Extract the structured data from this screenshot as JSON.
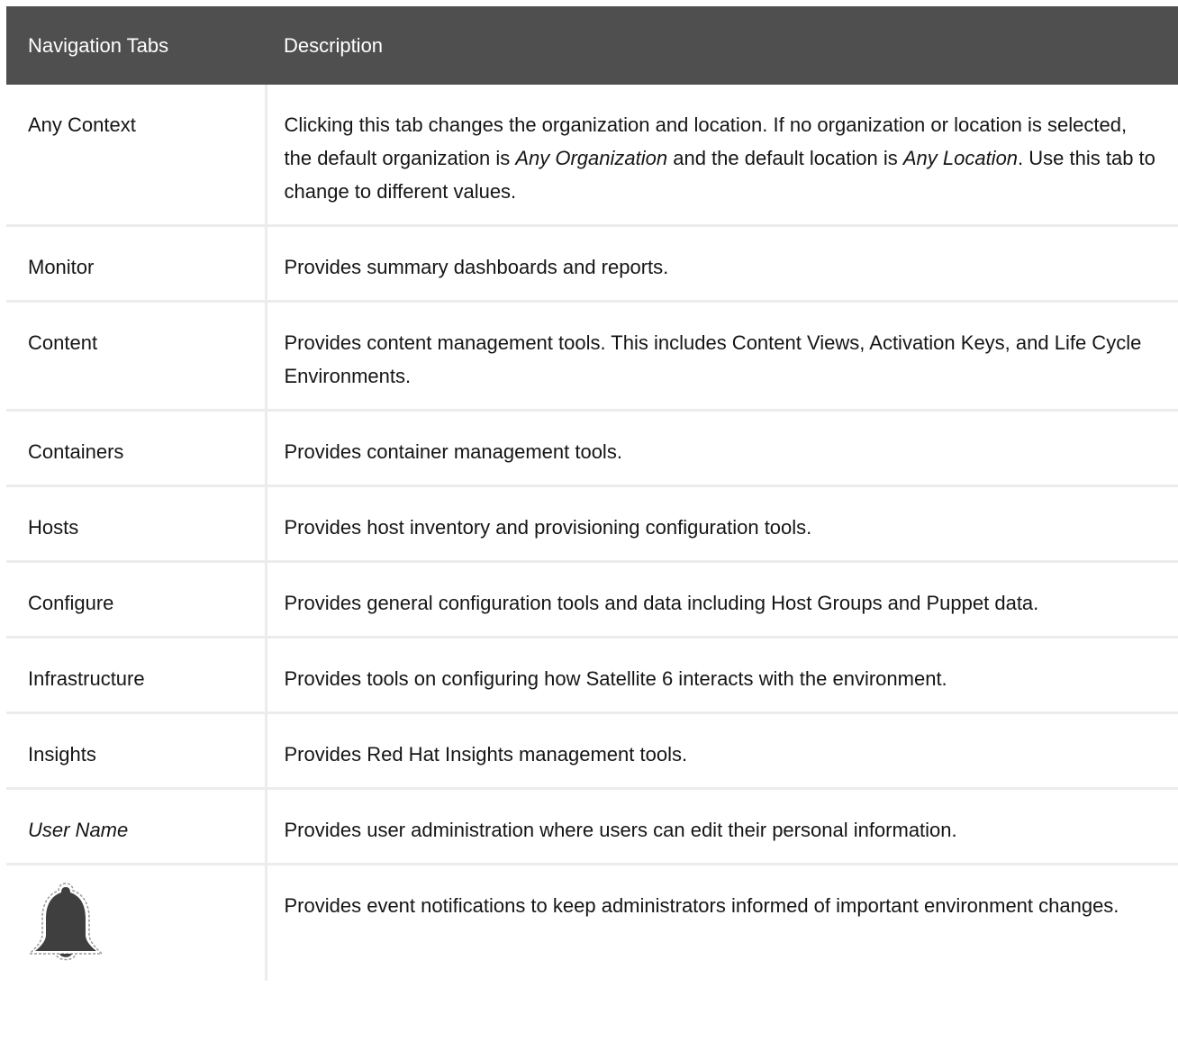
{
  "header": {
    "col1": "Navigation Tabs",
    "col2": "Description"
  },
  "rows": [
    {
      "tab": "Any Context",
      "desc_parts": [
        "Clicking this tab changes the organization and location. If no organization or location is selected, the default organization is ",
        "Any Organization",
        " and the default location is ",
        "Any Location",
        ". Use this tab to change to different values."
      ]
    },
    {
      "tab": "Monitor",
      "desc": "Provides summary dashboards and reports."
    },
    {
      "tab": "Content",
      "desc": "Provides content management tools. This includes Content Views, Activation Keys, and Life Cycle Environments."
    },
    {
      "tab": "Containers",
      "desc": "Provides container management tools."
    },
    {
      "tab": "Hosts",
      "desc": "Provides host inventory and provisioning configuration tools."
    },
    {
      "tab": "Configure",
      "desc": "Provides general configuration tools and data including Host Groups and Puppet data."
    },
    {
      "tab": "Infrastructure",
      "desc": "Provides tools on configuring how Satellite 6 interacts with the environment."
    },
    {
      "tab": "Insights",
      "desc": "Provides Red Hat Insights management tools."
    },
    {
      "tab": "User Name",
      "desc": "Provides user administration where users can edit their personal information."
    },
    {
      "icon": "bell-icon",
      "desc": "Provides event notifications to keep administrators informed of important environment changes."
    }
  ],
  "colors": {
    "header_bg": "#4f4f4f",
    "header_text": "#ffffff",
    "border": "#ececec",
    "text": "#151515",
    "bell_fill": "#3f3f3f"
  }
}
